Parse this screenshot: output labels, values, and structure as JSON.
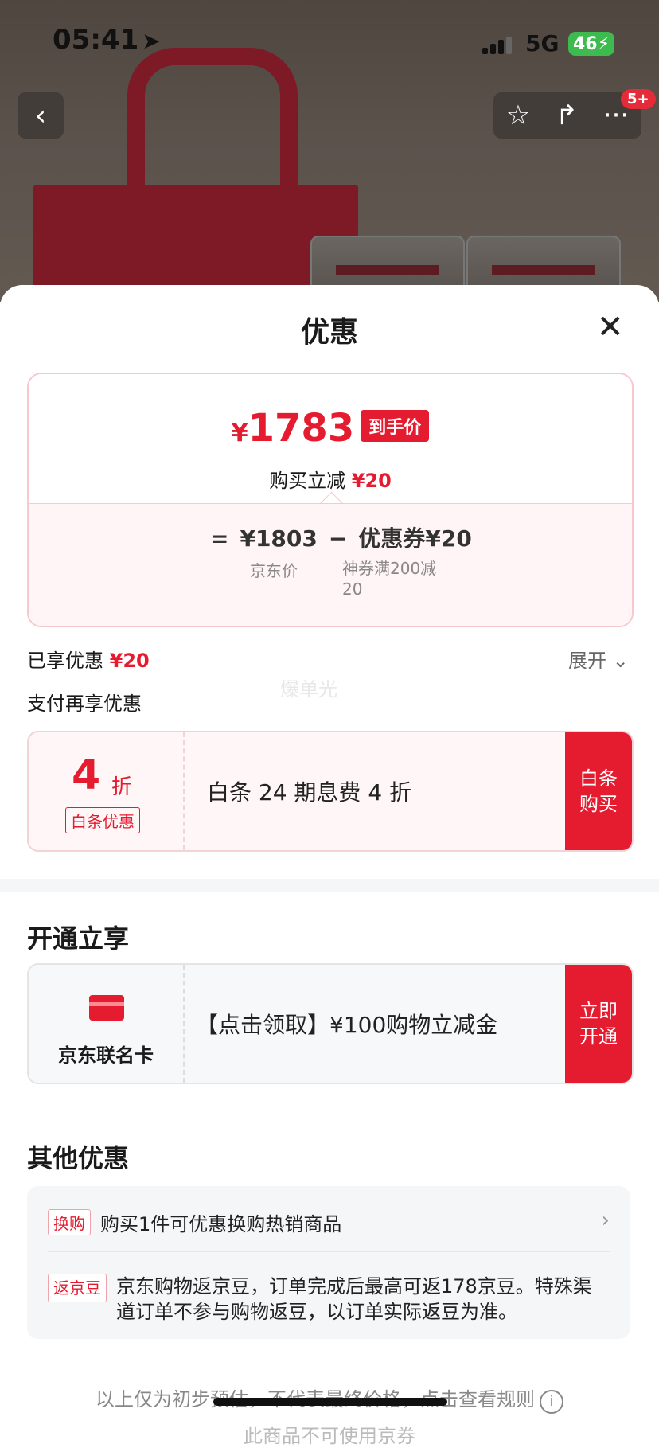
{
  "status_bar": {
    "time": "05:41",
    "network": "5G",
    "battery": "46"
  },
  "nav": {
    "back_icon": "chevron-left-icon",
    "notification_badge": "5+"
  },
  "sheet": {
    "title": "优惠",
    "final_price": {
      "currency": "¥",
      "amount": "1783",
      "tag": "到手价"
    },
    "instant_discount": {
      "label": "购买立减",
      "amount": "¥20"
    },
    "formula": {
      "eq": "=",
      "base_price": "¥1803",
      "minus": "−",
      "coupon": "优惠券¥20",
      "base_label": "京东价",
      "coupon_desc": "神券满200减20"
    },
    "enjoyed": {
      "label": "已享优惠",
      "amount": "¥20"
    },
    "expand_label": "展开",
    "pay_more_label": "支付再享优惠",
    "watermark": "爆单光",
    "baitiao": {
      "discount_num": "4",
      "discount_unit": "折",
      "tag": "白条优惠",
      "text": "白条 24 期息费 4 折",
      "button": "白条购买"
    },
    "open_section": {
      "title": "开通立享",
      "card_name": "京东联名卡",
      "text": "【点击领取】¥100购物立减金",
      "button": "立即开通"
    },
    "other_section": {
      "title": "其他优惠",
      "items": [
        {
          "tag": "换购",
          "text": "购买1件可优惠换购热销商品"
        },
        {
          "tag": "返京豆",
          "text": "京东购物返京豆，订单完成后最高可返178京豆。特殊渠道订单不参与购物返豆，以订单实际返豆为准。"
        }
      ]
    },
    "footnote": "以上仅为初步预估，不代表最终价格，点击查看规则",
    "footnote2": "此商品不可使用京券"
  }
}
